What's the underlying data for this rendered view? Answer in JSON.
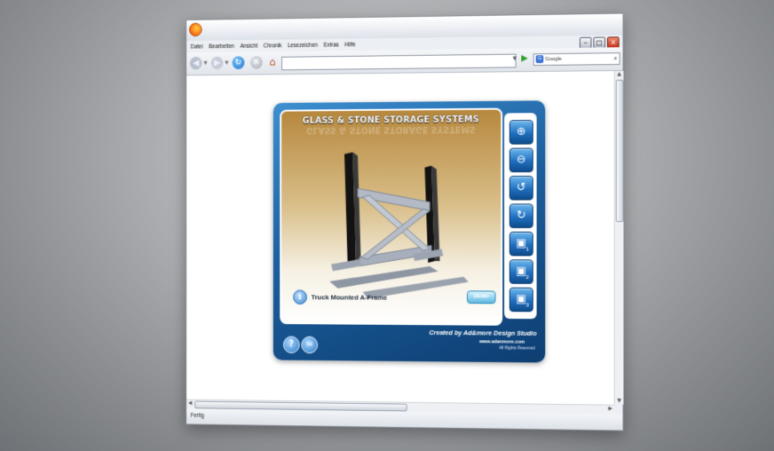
{
  "browser": {
    "menu": [
      "Datei",
      "Bearbeiten",
      "Ansicht",
      "Chronik",
      "Lesezeichen",
      "Extras",
      "Hilfe"
    ],
    "url": "",
    "search_placeholder": "Google",
    "status": "Fertig",
    "window_buttons": {
      "minimize": "–",
      "maximize": "□",
      "close": "×"
    }
  },
  "app": {
    "title": "GLASS & STONE STORAGE SYSTEMS",
    "caption": "Truck Mounted A-Frame",
    "demo_label": "DEMO",
    "credit_line1": "Created by Ad&more Design Studio",
    "credit_line2": "www.adanmore.com",
    "credit_line3": "All Rights Reserved",
    "tools": [
      {
        "icon": "zoom-in-icon",
        "glyph": "⊕",
        "num": ""
      },
      {
        "icon": "zoom-out-icon",
        "glyph": "⊖",
        "num": ""
      },
      {
        "icon": "rotate-left-icon",
        "glyph": "↺",
        "num": ""
      },
      {
        "icon": "rotate-right-icon",
        "glyph": "↻",
        "num": ""
      },
      {
        "icon": "camera-1-icon",
        "glyph": "▣",
        "num": "1"
      },
      {
        "icon": "camera-2-icon",
        "glyph": "▣",
        "num": "2"
      },
      {
        "icon": "camera-3-icon",
        "glyph": "▣",
        "num": "3"
      }
    ],
    "help_glyph": "?",
    "mail_glyph": "✉",
    "info_glyph": "i",
    "colors": {
      "panel_blue": "#1c5f9e",
      "stage_gold": "#b7883e",
      "frame_black": "#111111",
      "frame_steel": "#a9b0bd"
    }
  }
}
